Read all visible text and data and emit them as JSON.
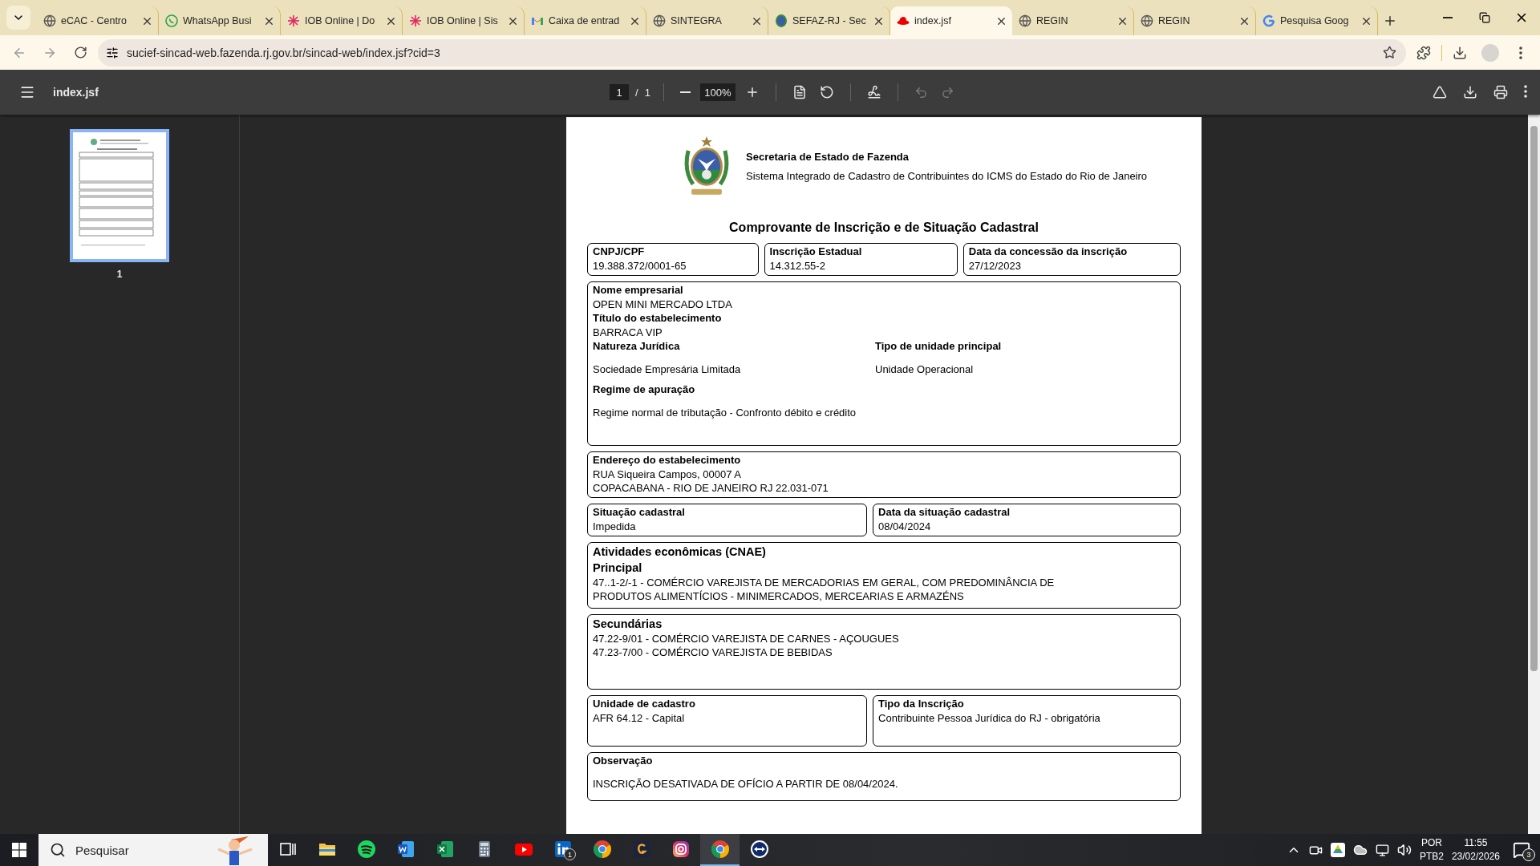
{
  "browser": {
    "tabs": [
      {
        "title": "eCAC - Centro",
        "kind": "globe",
        "selected": false
      },
      {
        "title": "WhatsApp Busi",
        "kind": "whatsapp",
        "selected": false
      },
      {
        "title": "IOB Online | Do",
        "kind": "asterisk",
        "selected": false
      },
      {
        "title": "IOB Online | Sis",
        "kind": "asterisk",
        "selected": false
      },
      {
        "title": "Caixa de entrad",
        "kind": "gmail",
        "selected": false
      },
      {
        "title": "SINTEGRA",
        "kind": "globe",
        "selected": false
      },
      {
        "title": "SEFAZ-RJ - Sec",
        "kind": "crest",
        "selected": false
      },
      {
        "title": "index.jsf",
        "kind": "hat",
        "selected": true
      },
      {
        "title": "REGIN",
        "kind": "globe",
        "selected": false
      },
      {
        "title": "REGIN",
        "kind": "globe",
        "selected": false
      },
      {
        "title": "Pesquisa Goog",
        "kind": "google",
        "selected": false
      }
    ],
    "address": "sucief-sincad-web.fazenda.rj.gov.br/sincad-web/index.jsf?cid=3"
  },
  "viewer": {
    "filename": "index.jsf",
    "page": "1",
    "separator": "/",
    "page_total": "1",
    "zoom": "100%",
    "thumbnails": [
      {
        "label": "1",
        "selected": true
      }
    ]
  },
  "document": {
    "agency": "Secretaria de Estado de Fazenda",
    "system": "Sistema Integrado de Cadastro de Contribuintes do ICMS do Estado do Rio de Janeiro",
    "title": "Comprovante de Inscrição e de Situação Cadastral",
    "rows": [
      {
        "boxes": [
          {
            "items": [
              {
                "kind": "label",
                "text": "CNPJ/CPF"
              },
              {
                "kind": "value",
                "text": "19.388.372/0001-65"
              }
            ]
          },
          {
            "items": [
              {
                "kind": "label",
                "text": "Inscrição Estadual"
              },
              {
                "kind": "value",
                "text": "14.312.55-2"
              }
            ]
          },
          {
            "items": [
              {
                "kind": "label",
                "text": "Data da concessão da inscrição"
              },
              {
                "kind": "value",
                "text": "27/12/2023"
              }
            ]
          }
        ]
      },
      {
        "boxes": [
          {
            "items": [
              {
                "kind": "label",
                "text": "Nome empresarial"
              },
              {
                "kind": "value",
                "text": "OPEN MINI MERCADO LTDA"
              },
              {
                "kind": "label",
                "text": "Título do estabelecimento"
              },
              {
                "kind": "value",
                "text": "BARRACA VIP"
              },
              {
                "kind": "pair",
                "columns": [
                  {
                    "label": "Natureza Jurídica",
                    "value": "Sociedade Empresária Limitada"
                  },
                  {
                    "label": "Tipo de unidade principal",
                    "value": "Unidade Operacional"
                  }
                ]
              },
              {
                "kind": "spaced",
                "label": "Regime de apuração",
                "value": "Regime normal de tributação - Confronto débito e crédito"
              }
            ]
          }
        ]
      },
      {
        "boxes": [
          {
            "items": [
              {
                "kind": "label",
                "text": "Endereço do estabelecimento"
              },
              {
                "kind": "value",
                "text": "RUA Siqueira Campos, 00007 A"
              },
              {
                "kind": "value",
                "text": "COPACABANA - RIO DE JANEIRO RJ 22.031-071"
              }
            ]
          }
        ]
      },
      {
        "boxes": [
          {
            "items": [
              {
                "kind": "label",
                "text": "Situação cadastral"
              },
              {
                "kind": "value",
                "text": "Impedida"
              }
            ]
          },
          {
            "items": [
              {
                "kind": "label",
                "text": "Data da situação cadastral"
              },
              {
                "kind": "value",
                "text": "08/04/2024"
              }
            ]
          }
        ]
      },
      {
        "boxes": [
          {
            "items": [
              {
                "kind": "heading",
                "text": "Atividades econômicas (CNAE)"
              },
              {
                "kind": "heading",
                "text": "Principal"
              },
              {
                "kind": "value",
                "text": "47..1-2/-1 - COMÉRCIO VAREJISTA DE MERCADORIAS EM GERAL, COM PREDOMINÂNCIA DE"
              },
              {
                "kind": "value",
                "text": "PRODUTOS ALIMENTÍCIOS - MINIMERCADOS, MERCEARIAS E ARMAZÉNS"
              }
            ]
          }
        ]
      },
      {
        "boxes": [
          {
            "items": [
              {
                "kind": "heading",
                "text": "Secundárias"
              },
              {
                "kind": "value",
                "text": "47.22-9/01 - COMÉRCIO VAREJISTA DE CARNES - AÇOUGUES"
              },
              {
                "kind": "value",
                "text": "47.23-7/00 - COMÉRCIO VAREJISTA DE BEBIDAS"
              }
            ]
          }
        ]
      },
      {
        "boxes": [
          {
            "items": [
              {
                "kind": "label",
                "text": "Unidade de cadastro"
              },
              {
                "kind": "value",
                "text": "AFR 64.12 - Capital"
              }
            ]
          },
          {
            "items": [
              {
                "kind": "label",
                "text": "Tipo da Inscrição"
              },
              {
                "kind": "value",
                "text": "Contribuinte Pessoa Jurídica do RJ - obrigatória"
              }
            ]
          }
        ]
      },
      {
        "boxes": [
          {
            "items": [
              {
                "kind": "spaced",
                "label": "Observação",
                "value": "INSCRIÇÃO DESATIVADA DE OFÍCIO A PARTIR DE 08/04/2024."
              }
            ]
          }
        ]
      }
    ]
  },
  "taskbar": {
    "search_placeholder": "Pesquisar",
    "apps": [
      {
        "kind": "taskview",
        "selected": false
      },
      {
        "kind": "folder",
        "selected": false
      },
      {
        "kind": "spotify",
        "selected": false
      },
      {
        "kind": "word",
        "selected": false
      },
      {
        "kind": "excel",
        "selected": false
      },
      {
        "kind": "calculator",
        "selected": false
      },
      {
        "kind": "youtube",
        "selected": false
      },
      {
        "kind": "linkedin",
        "selected": false,
        "badge": "1"
      },
      {
        "kind": "chrome",
        "selected": false
      },
      {
        "kind": "gc",
        "selected": false
      },
      {
        "kind": "instagram",
        "selected": false
      },
      {
        "kind": "chrome",
        "selected": true
      },
      {
        "kind": "remote",
        "selected": false
      }
    ],
    "language": "POR",
    "layout": "PTB2",
    "time": "11:55",
    "date": "23/02/2026",
    "notifications": "3"
  }
}
